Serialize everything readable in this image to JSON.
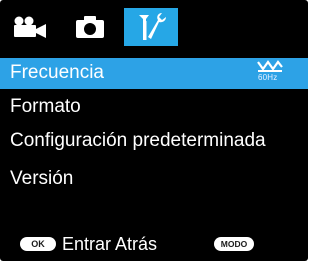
{
  "tabs": [
    {
      "icon": "video-camera-icon",
      "active": false
    },
    {
      "icon": "photo-camera-icon",
      "active": false
    },
    {
      "icon": "settings-tools-icon",
      "active": true
    }
  ],
  "menu": {
    "items": [
      {
        "label": "Frecuencia",
        "selected": true,
        "value": "60Hz",
        "value_icon": "flicker-frequency-icon"
      },
      {
        "label": "Formato",
        "selected": false
      },
      {
        "label": "Configuración predeterminada",
        "selected": false
      },
      {
        "label": "Versión",
        "selected": false
      }
    ]
  },
  "footer": {
    "ok_label": "OK",
    "action_text": "Entrar Atrás",
    "mode_label": "MODO"
  },
  "colors": {
    "background": "#000000",
    "highlight": "#2da2e6",
    "text": "#ffffff"
  }
}
